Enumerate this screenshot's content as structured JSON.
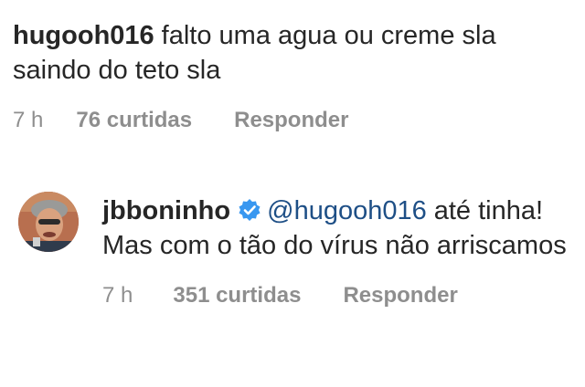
{
  "comments": [
    {
      "username": "hugooh016",
      "text": "falto uma agua ou creme sla saindo do teto sla",
      "time": "7 h",
      "likes": "76 curtidas",
      "reply_label": "Responder"
    }
  ],
  "reply": {
    "username": "jbboninho",
    "verified": true,
    "verified_icon": "verified-badge-icon",
    "mention": "@hugooh016",
    "text": "até tinha! Mas com o tão do vírus não arriscamos",
    "time": "7 h",
    "likes": "351 curtidas",
    "reply_label": "Responder",
    "avatar_icon": "avatar",
    "colors": {
      "mention": "#1e4f86",
      "verified": "#3897f0"
    }
  },
  "colors": {
    "text": "#262626",
    "meta": "#8e8e8e"
  }
}
